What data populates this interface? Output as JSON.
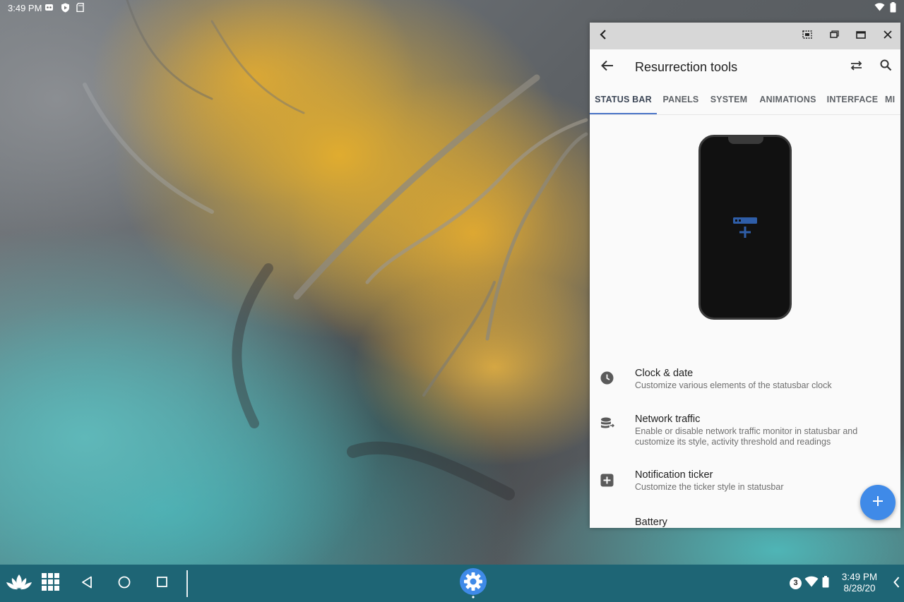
{
  "statusbar": {
    "time": "3:49 PM",
    "icons": [
      "notification-app-icon",
      "shield-icon",
      "sd-card-icon",
      "wifi-icon",
      "battery-icon"
    ]
  },
  "window": {
    "caption_buttons": [
      "back-icon",
      "screenshot-icon",
      "restore-icon",
      "maximize-icon",
      "close-icon"
    ],
    "appbar": {
      "title": "Resurrection tools",
      "actions": [
        "swap-icon",
        "search-icon"
      ]
    },
    "tabs": [
      {
        "label": "STATUS BAR",
        "active": true
      },
      {
        "label": "PANELS",
        "active": false
      },
      {
        "label": "SYSTEM",
        "active": false
      },
      {
        "label": "ANIMATIONS",
        "active": false
      },
      {
        "label": "INTERFACE",
        "active": false
      },
      {
        "label": "MI",
        "active": false
      }
    ],
    "items": [
      {
        "title": "Clock & date",
        "subtitle": "Customize various elements of the statusbar clock",
        "icon": "clock-icon"
      },
      {
        "title": "Network traffic",
        "subtitle": "Enable or disable network traffic monitor in statusbar and customize its style, activity threshold and readings",
        "icon": "network-traffic-icon"
      },
      {
        "title": "Notification ticker",
        "subtitle": "Customize the ticker style in statusbar",
        "icon": "ticker-icon"
      },
      {
        "title": "Battery",
        "subtitle": "",
        "icon": "battery-icon"
      }
    ],
    "fab": "add-icon"
  },
  "taskbar": {
    "buttons": [
      "lotus-icon",
      "app-drawer-icon",
      "back-nav-icon",
      "home-nav-icon",
      "recents-nav-icon",
      "settings-app-icon"
    ],
    "notification_count": "3",
    "time": "3:49 PM",
    "date": "8/28/20"
  },
  "colors": {
    "accent": "#4b76c8",
    "fab": "#3f8ae8",
    "taskbar": "#1e6575",
    "caption": "#d7d7d7"
  }
}
